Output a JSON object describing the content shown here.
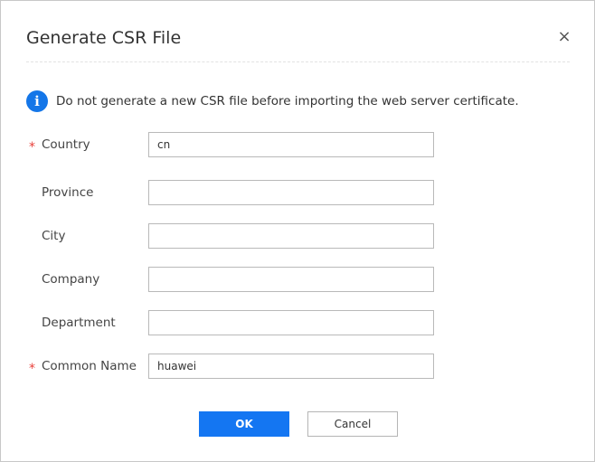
{
  "dialog": {
    "title": "Generate CSR File",
    "close_glyph": "×",
    "close_icon": "close-icon"
  },
  "info": {
    "icon": "info-icon",
    "icon_glyph": "i",
    "icon_color": "#1476e8",
    "message": "Do not generate a new CSR file before importing the web server certificate."
  },
  "form": {
    "required_mark": "*",
    "fields": [
      {
        "label": "Country",
        "required": true,
        "value": ""
      },
      {
        "label": "Province",
        "required": false,
        "value": ""
      },
      {
        "label": "City",
        "required": false,
        "value": ""
      },
      {
        "label": "Company",
        "required": false,
        "value": ""
      },
      {
        "label": "Department",
        "required": false,
        "value": ""
      },
      {
        "label": "Common Name",
        "required": true,
        "value": ""
      }
    ],
    "country_value": "cn",
    "common_name_value": "huawei",
    "province_value": "",
    "city_value": "",
    "company_value": "",
    "department_value": ""
  },
  "buttons": {
    "ok_label": "OK",
    "cancel_label": "Cancel",
    "ok_color": "#1476f2"
  }
}
